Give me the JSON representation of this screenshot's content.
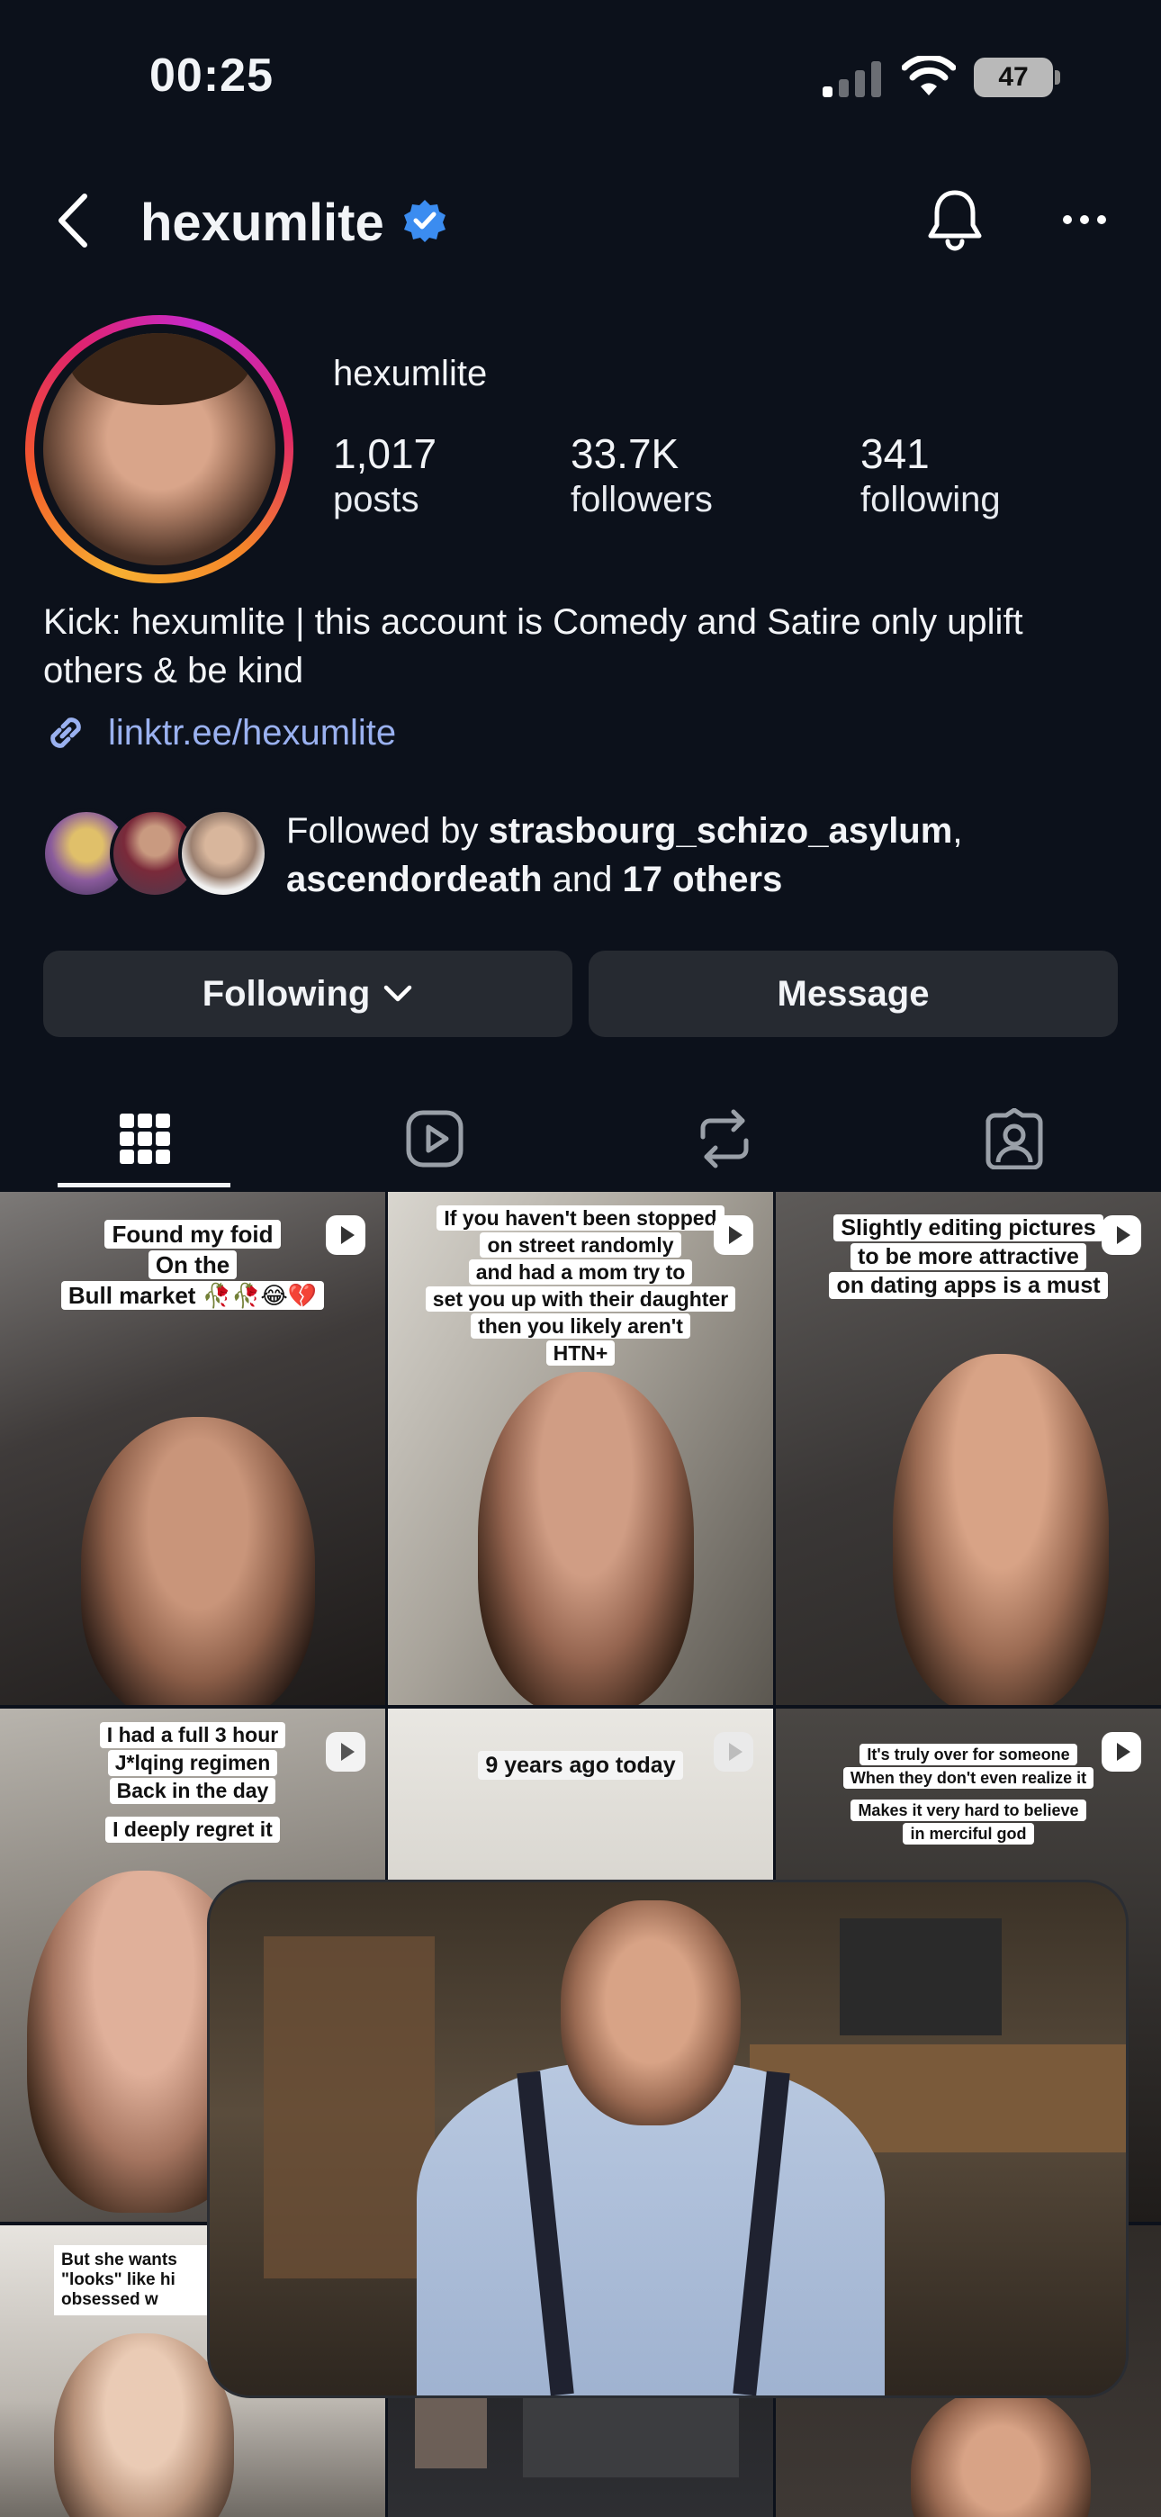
{
  "status_bar": {
    "time": "00:25",
    "battery": "47"
  },
  "header": {
    "handle": "hexumlite"
  },
  "profile": {
    "name": "hexumlite",
    "stats": [
      {
        "value": "1,017",
        "label": "posts"
      },
      {
        "value": "33.7K",
        "label": "followers"
      },
      {
        "value": "341",
        "label": "following"
      }
    ],
    "bio": "Kick: hexumlite | this account is Comedy and Satire only uplift others & be kind",
    "link": "linktr.ee/hexumlite",
    "followed_by": {
      "prefix": "Followed by ",
      "user1": "strasbourg_schizo_asylum",
      "separator": ",",
      "user2": "ascendordeath",
      "middle": " and ",
      "others": "17 others"
    }
  },
  "actions": {
    "following_label": "Following",
    "message_label": "Message"
  },
  "tabs": [
    {
      "icon": "grid-icon",
      "active": true
    },
    {
      "icon": "reels-icon",
      "active": false
    },
    {
      "icon": "reposts-icon",
      "active": false
    },
    {
      "icon": "tagged-icon",
      "active": false
    }
  ],
  "posts": [
    {
      "caption": [
        "Found my foid",
        "On the",
        "Bull market 🥀🥀😂💔"
      ]
    },
    {
      "caption": [
        "If you haven't been stopped",
        "on street randomly",
        "and had a mom try to",
        "set you up with their daughter",
        "then you likely aren't",
        "HTN+"
      ]
    },
    {
      "caption": [
        "Slightly editing pictures",
        "to be more attractive",
        "on dating apps is a must"
      ]
    },
    {
      "caption": [
        "I had a full 3 hour",
        "J*lqing regimen",
        "Back in the day",
        "I deeply regret it"
      ]
    },
    {
      "caption": [
        "9 years ago today"
      ]
    },
    {
      "caption": [
        "It's truly over for someone",
        "When they don't even realize it",
        "Makes it very hard to believe",
        "in merciful god"
      ]
    },
    {
      "caption": [
        "But she wants",
        "\"looks\" like hi",
        "obsessed w"
      ]
    }
  ],
  "colors": {
    "background": "#0c111b",
    "button": "#262a31",
    "link": "#9ab1f0",
    "verified": "#3b8cf0"
  }
}
